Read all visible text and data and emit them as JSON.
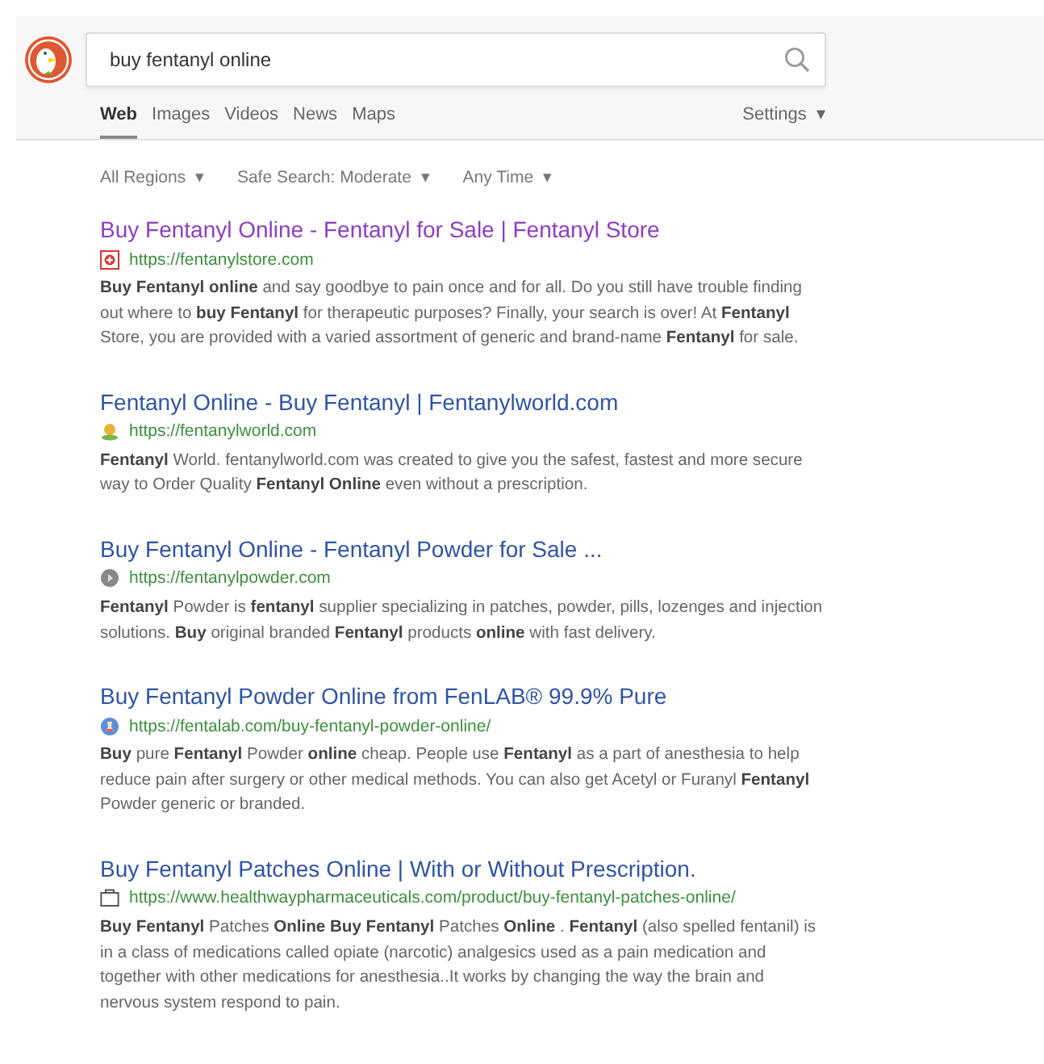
{
  "search": {
    "query": "buy fentanyl online"
  },
  "tabs": [
    {
      "label": "Web",
      "selected": true
    },
    {
      "label": "Images",
      "selected": false
    },
    {
      "label": "Videos",
      "selected": false
    },
    {
      "label": "News",
      "selected": false
    },
    {
      "label": "Maps",
      "selected": false
    }
  ],
  "settings": {
    "label": "Settings",
    "caret": "▾"
  },
  "filters": [
    {
      "label": "All Regions",
      "caret": "▾"
    },
    {
      "label": "Safe Search: Moderate",
      "caret": "▾"
    },
    {
      "label": "Any Time",
      "caret": "▾"
    }
  ],
  "results": [
    {
      "title": "Buy Fentanyl Online - Fentanyl for Sale | Fentanyl Store",
      "visited": true,
      "url": "https://fentanylstore.com",
      "snippet": "**Buy Fentanyl online** and say goodbye to pain once and for all. Do you still have trouble finding out where to **buy Fentanyl** for therapeutic purposes? Finally, your search is over! At **Fentanyl** Store, you are provided with a varied assortment of generic and brand-name **Fentanyl** for sale."
    },
    {
      "title": "Fentanyl Online - Buy Fentanyl | Fentanylworld.com",
      "visited": false,
      "url": "https://fentanylworld.com",
      "snippet": "**Fentanyl** World. fentanylworld.com was created to give you the safest, fastest and more secure way to Order Quality **Fentanyl Online** even without a prescription."
    },
    {
      "title": "Buy Fentanyl Online - Fentanyl Powder for Sale ...",
      "visited": false,
      "url": "https://fentanylpowder.com",
      "snippet": "**Fentanyl** Powder is **fentanyl** supplier specializing in patches, powder, pills, lozenges and injection solutions. **Buy** original branded **Fentanyl** products **online** with fast delivery."
    },
    {
      "title": "Buy Fentanyl Powder Online from FenLAB® 99.9% Pure",
      "visited": false,
      "url": "https://fentalab.com/buy-fentanyl-powder-online/",
      "snippet": "**Buy** pure **Fentanyl** Powder **online** cheap. People use **Fentanyl** as a part of anesthesia to help reduce pain after surgery or other medical methods. You can also get Acetyl or Furanyl **Fentanyl** Powder generic or branded."
    },
    {
      "title": "Buy Fentanyl Patches Online | With or Without Prescription.",
      "visited": false,
      "url": "https://www.healthwaypharmaceuticals.com/product/buy-fentanyl-patches-online/",
      "snippet": "**Buy Fentanyl** Patches **Online Buy Fentanyl** Patches **Online** . **Fentanyl** (also spelled fentanil) is in a class of medications called opiate (narcotic) analgesics used as a pain medication and together with other medications for anesthesia..It works by changing the way the brain and nervous system respond to pain."
    }
  ]
}
